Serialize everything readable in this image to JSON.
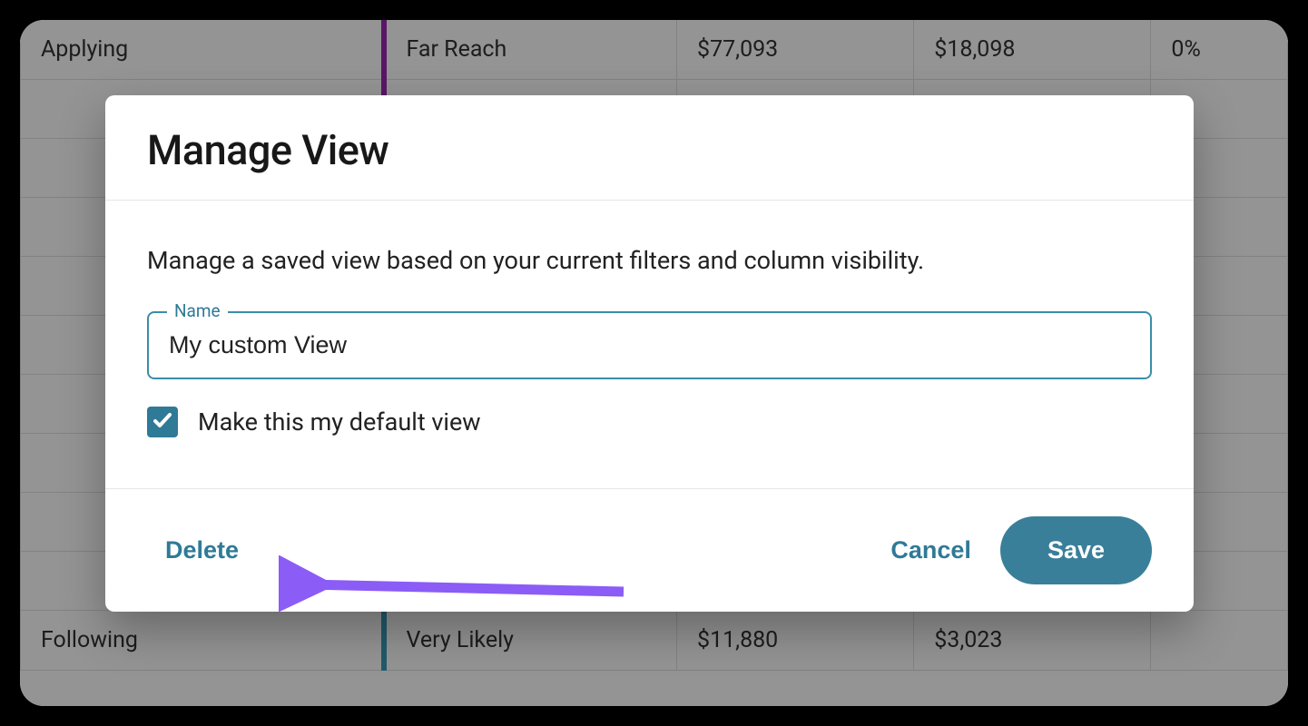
{
  "modal": {
    "title": "Manage View",
    "description": "Manage a saved view based on your current filters and column visibility.",
    "name_field": {
      "label": "Name",
      "value": "My custom View"
    },
    "default_checkbox": {
      "checked": true,
      "label": "Make this my default view"
    },
    "buttons": {
      "delete": "Delete",
      "cancel": "Cancel",
      "save": "Save"
    }
  },
  "background": {
    "row_top": {
      "c1": "Applying",
      "c2": "Far Reach",
      "c3": "$77,093",
      "c4": "$18,098",
      "c5": "0%"
    },
    "row_bottom": {
      "c1": "Following",
      "c2": "Very Likely",
      "c3": "$11,880",
      "c4": "$3,023"
    }
  },
  "colors": {
    "accent": "#2f7a96",
    "arrow": "#8b5cf6"
  }
}
